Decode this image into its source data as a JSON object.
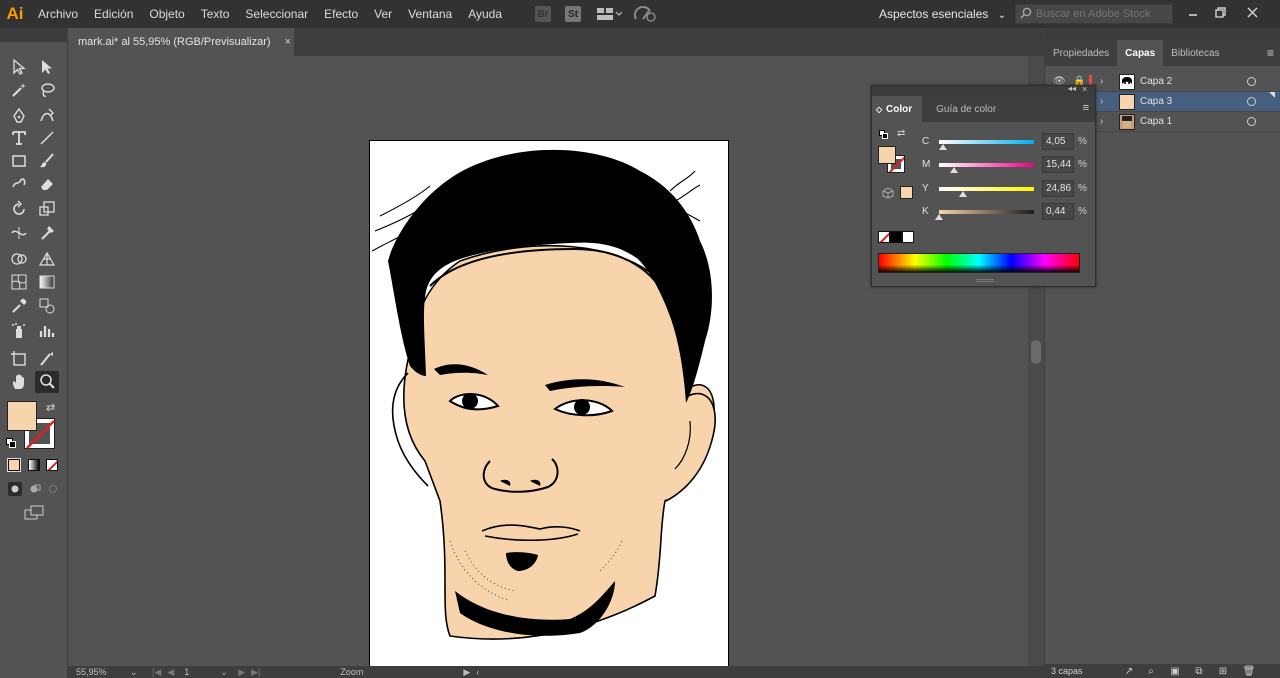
{
  "app": {
    "logo": "Ai"
  },
  "menu": [
    "Archivo",
    "Edición",
    "Objeto",
    "Texto",
    "Seleccionar",
    "Efecto",
    "Ver",
    "Ventana",
    "Ayuda"
  ],
  "bridge_icons": [
    "Br",
    "St"
  ],
  "workspace": {
    "label": "Aspectos esenciales",
    "icon": "chevron-down-icon"
  },
  "search": {
    "placeholder": "Buscar en Adobe Stock"
  },
  "window_controls": [
    "minimize-icon",
    "restore-icon",
    "close-icon"
  ],
  "document": {
    "tab_title": "mark.ai* al 55,95% (RGB/Previsualizar)",
    "close": "×"
  },
  "status": {
    "zoom": "55,95%",
    "page": "1",
    "tool_label": "Zoom"
  },
  "colors": {
    "fill": "#f8d4ac",
    "skin": "#f8d4ac",
    "hair": "#000000",
    "accent_ai": "#ff9a00",
    "layer_red": "#e24b4b"
  },
  "right_panel": {
    "tabs": [
      "Propiedades",
      "Capas",
      "Bibliotecas"
    ],
    "active_tab": "Capas",
    "layers": [
      {
        "name": "Capa 2",
        "visible": true,
        "locked": true,
        "selected": false
      },
      {
        "name": "Capa 3",
        "visible": false,
        "locked": false,
        "selected": true
      },
      {
        "name": "Capa 1",
        "visible": false,
        "locked": false,
        "selected": false
      }
    ],
    "footer_count": "3 capas"
  },
  "color_panel": {
    "tabs": [
      "Color",
      "Guía de color"
    ],
    "active_tab": "Color",
    "sliders": [
      {
        "label": "C",
        "value": "4,05",
        "unit": "%",
        "fraction": 0.0405
      },
      {
        "label": "M",
        "value": "15,44",
        "unit": "%",
        "fraction": 0.1544
      },
      {
        "label": "Y",
        "value": "24,86",
        "unit": "%",
        "fraction": 0.2486
      },
      {
        "label": "K",
        "value": "0,44",
        "unit": "%",
        "fraction": 0.0044
      }
    ]
  },
  "tools": [
    "selection-tool-icon",
    "direct-selection-tool-icon",
    "magic-wand-icon",
    "lasso-icon",
    "pen-tool-icon",
    "curvature-tool-icon",
    "type-tool-icon",
    "line-tool-icon",
    "rectangle-tool-icon",
    "paintbrush-icon",
    "shaper-tool-icon",
    "eraser-icon",
    "rotate-tool-icon",
    "scale-tool-icon",
    "width-tool-icon",
    "puppet-warp-icon",
    "shape-builder-icon",
    "perspective-grid-icon",
    "mesh-tool-icon",
    "gradient-tool-icon",
    "eyedropper-icon",
    "blend-tool-icon",
    "symbol-sprayer-icon",
    "graph-tool-icon",
    "artboard-tool-icon",
    "slice-tool-icon",
    "hand-tool-icon",
    "zoom-tool-icon"
  ]
}
